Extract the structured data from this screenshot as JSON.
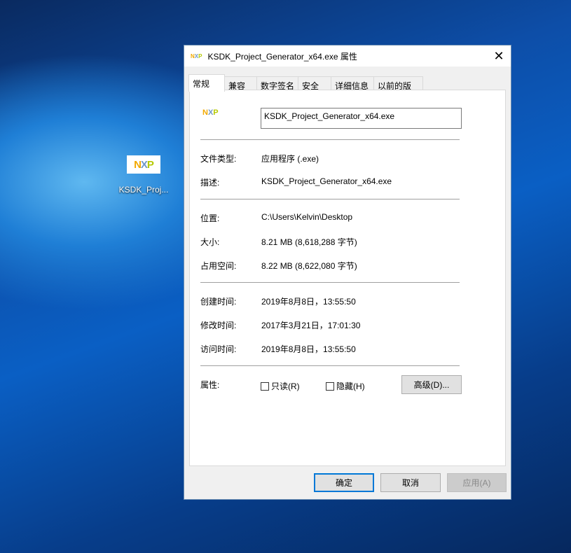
{
  "desktop": {
    "icon_label": "KSDK_Proj...",
    "logo": "NXP"
  },
  "dialog": {
    "title": "KSDK_Project_Generator_x64.exe 属性",
    "tabs": [
      "常规",
      "兼容性",
      "数字签名",
      "安全",
      "详细信息",
      "以前的版本"
    ],
    "file_name": "KSDK_Project_Generator_x64.exe",
    "rows": [
      {
        "label": "文件类型:",
        "value": "应用程序 (.exe)"
      },
      {
        "label": "描述:",
        "value": "KSDK_Project_Generator_x64.exe"
      },
      {
        "label": "位置:",
        "value": "C:\\Users\\Kelvin\\Desktop"
      },
      {
        "label": "大小:",
        "value": "8.21 MB (8,618,288 字节)"
      },
      {
        "label": "占用空间:",
        "value": "8.22 MB (8,622,080 字节)"
      },
      {
        "label": "创建时间:",
        "value": "2019年8月8日，13:55:50"
      },
      {
        "label": "修改时间:",
        "value": "2017年3月21日，17:01:30"
      },
      {
        "label": "访问时间:",
        "value": "2019年8月8日，13:55:50"
      }
    ],
    "attributes_label": "属性:",
    "readonly_label": "只读(R)",
    "hidden_label": "隐藏(H)",
    "advanced_label": "高级(D)...",
    "ok_label": "确定",
    "cancel_label": "取消",
    "apply_label": "应用(A)"
  }
}
